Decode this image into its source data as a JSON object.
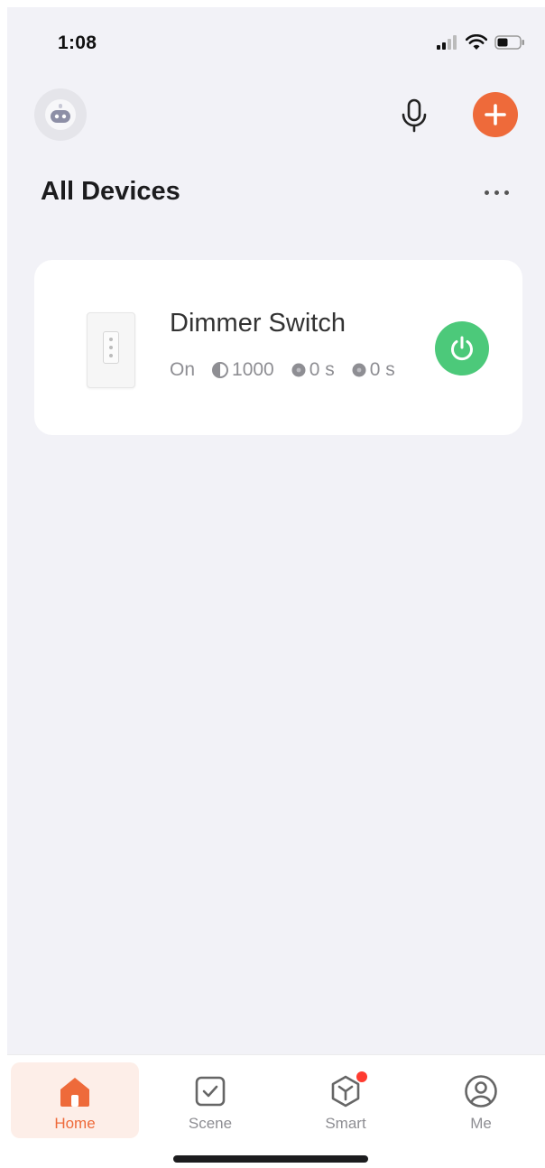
{
  "status_bar": {
    "time": "1:08",
    "icons": [
      "cellular-signal-icon",
      "wifi-icon",
      "battery-icon"
    ]
  },
  "header": {
    "avatar_icon": "home-robot-avatar-icon",
    "mic_icon": "microphone-icon",
    "add_icon": "plus-icon",
    "title": "All Devices",
    "more_icon": "more-dots-icon"
  },
  "device": {
    "name": "Dimmer Switch",
    "state": "On",
    "brightness": "1000",
    "timer1": "0 s",
    "timer2": "0 s",
    "power_on": true
  },
  "tabs": [
    {
      "label": "Home",
      "icon": "home-icon",
      "active": true
    },
    {
      "label": "Scene",
      "icon": "scene-check-icon",
      "active": false
    },
    {
      "label": "Smart",
      "icon": "smart-cube-icon",
      "active": false,
      "badge": true
    },
    {
      "label": "Me",
      "icon": "profile-icon",
      "active": false
    }
  ],
  "colors": {
    "accent": "#ee6a3a",
    "power_on": "#4cc97a",
    "background": "#f2f2f7",
    "badge": "#ff3b30"
  }
}
